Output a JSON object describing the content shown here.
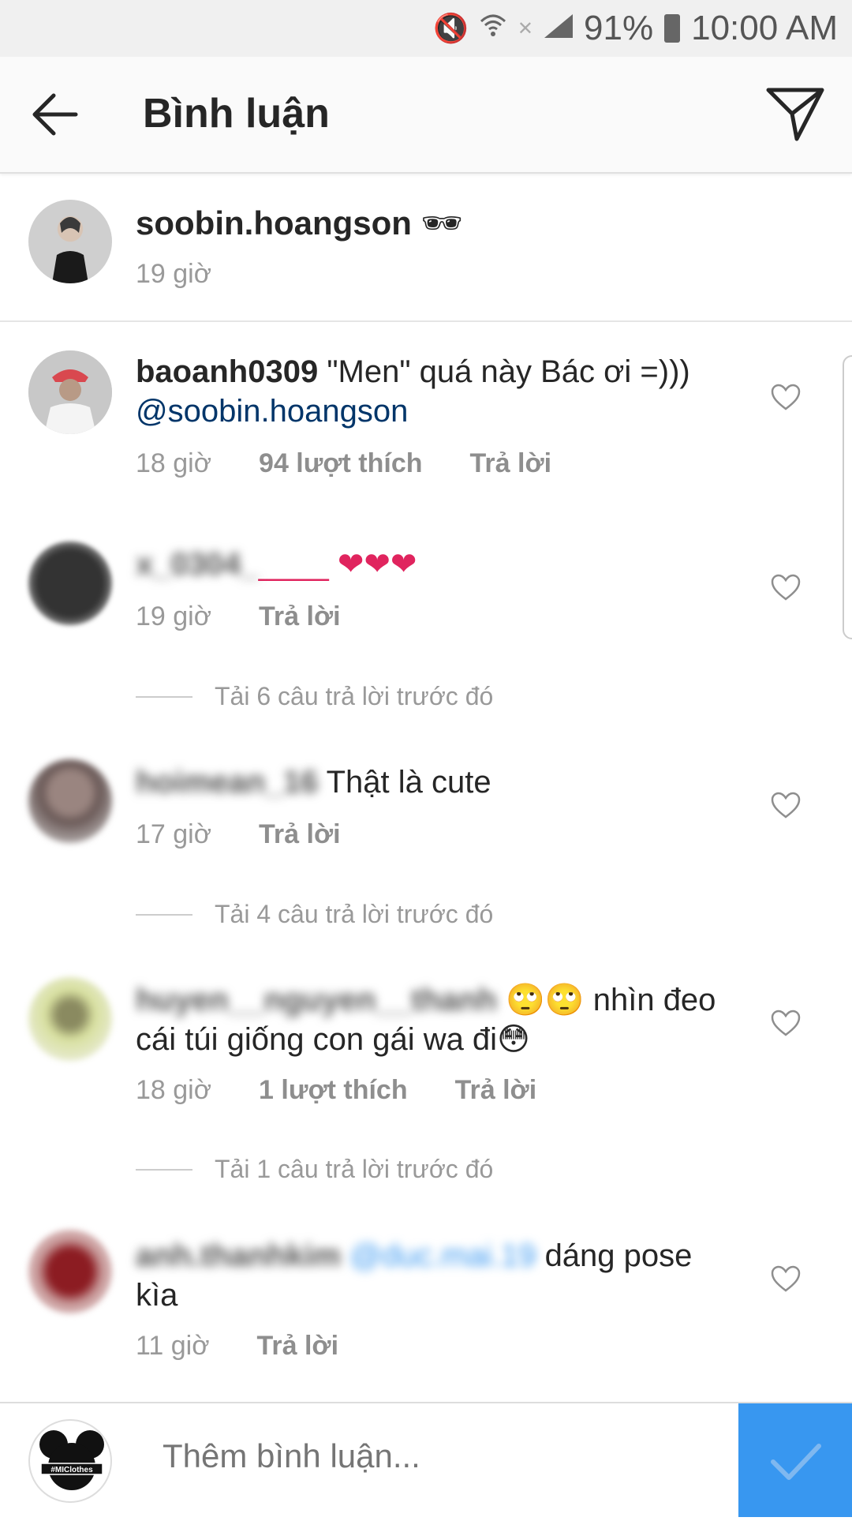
{
  "status": {
    "battery": "91%",
    "time": "10:00 AM"
  },
  "header": {
    "title": "Bình luận"
  },
  "caption": {
    "username": "soobin.hoangson",
    "emoji": "🕶",
    "time": "19 giờ"
  },
  "comments": [
    {
      "username": "baoanh0309",
      "text": "\"Men\" quá này Bác ơi =)))",
      "mention": "@soobin.hoangson",
      "time": "18 giờ",
      "likes": "94 lượt thích",
      "reply": "Trả lời"
    },
    {
      "username": "x_0304_",
      "text": "____ ❤❤❤",
      "time": "19 giờ",
      "reply": "Trả lời"
    },
    {
      "load_more": "Tải 6 câu trả lời trước đó"
    },
    {
      "username": "hoimean_16",
      "text": "Thật là cute",
      "time": "17 giờ",
      "reply": "Trả lời"
    },
    {
      "load_more": "Tải 4 câu trả lời trước đó"
    },
    {
      "username": "huyen__nguyen__thanh",
      "text": "🙄🙄 nhìn đeo cái túi giống con gái wa đi😳",
      "time": "18 giờ",
      "likes": "1 lượt thích",
      "reply": "Trả lời"
    },
    {
      "load_more": "Tải 1 câu trả lời trước đó"
    },
    {
      "username": "anh.thanhkim",
      "mention": "@duc.mai.19",
      "text": "dáng pose kìa",
      "time": "11 giờ",
      "reply": "Trả lời"
    }
  ],
  "composer": {
    "placeholder": "Thêm bình luận...",
    "avatar_text": "#MIClothes"
  },
  "colors": {
    "accent": "#3897f0",
    "mention": "#003569"
  }
}
